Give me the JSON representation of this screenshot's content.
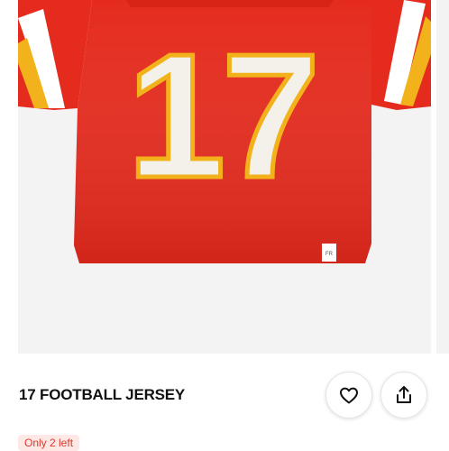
{
  "product": {
    "title": "17 FOOTBALL JERSEY",
    "jersey_number": "17",
    "stock_badge": "Only 2 left",
    "tag_text": "FR"
  },
  "actions": {
    "favorite_icon": "heart-icon",
    "share_icon": "share-icon"
  },
  "colors": {
    "jersey_red": "#e52b1e",
    "number_white": "#f4f0ea",
    "number_trim": "#f2b21b",
    "badge_bg": "#fde8e6",
    "badge_text": "#d93a2b"
  }
}
